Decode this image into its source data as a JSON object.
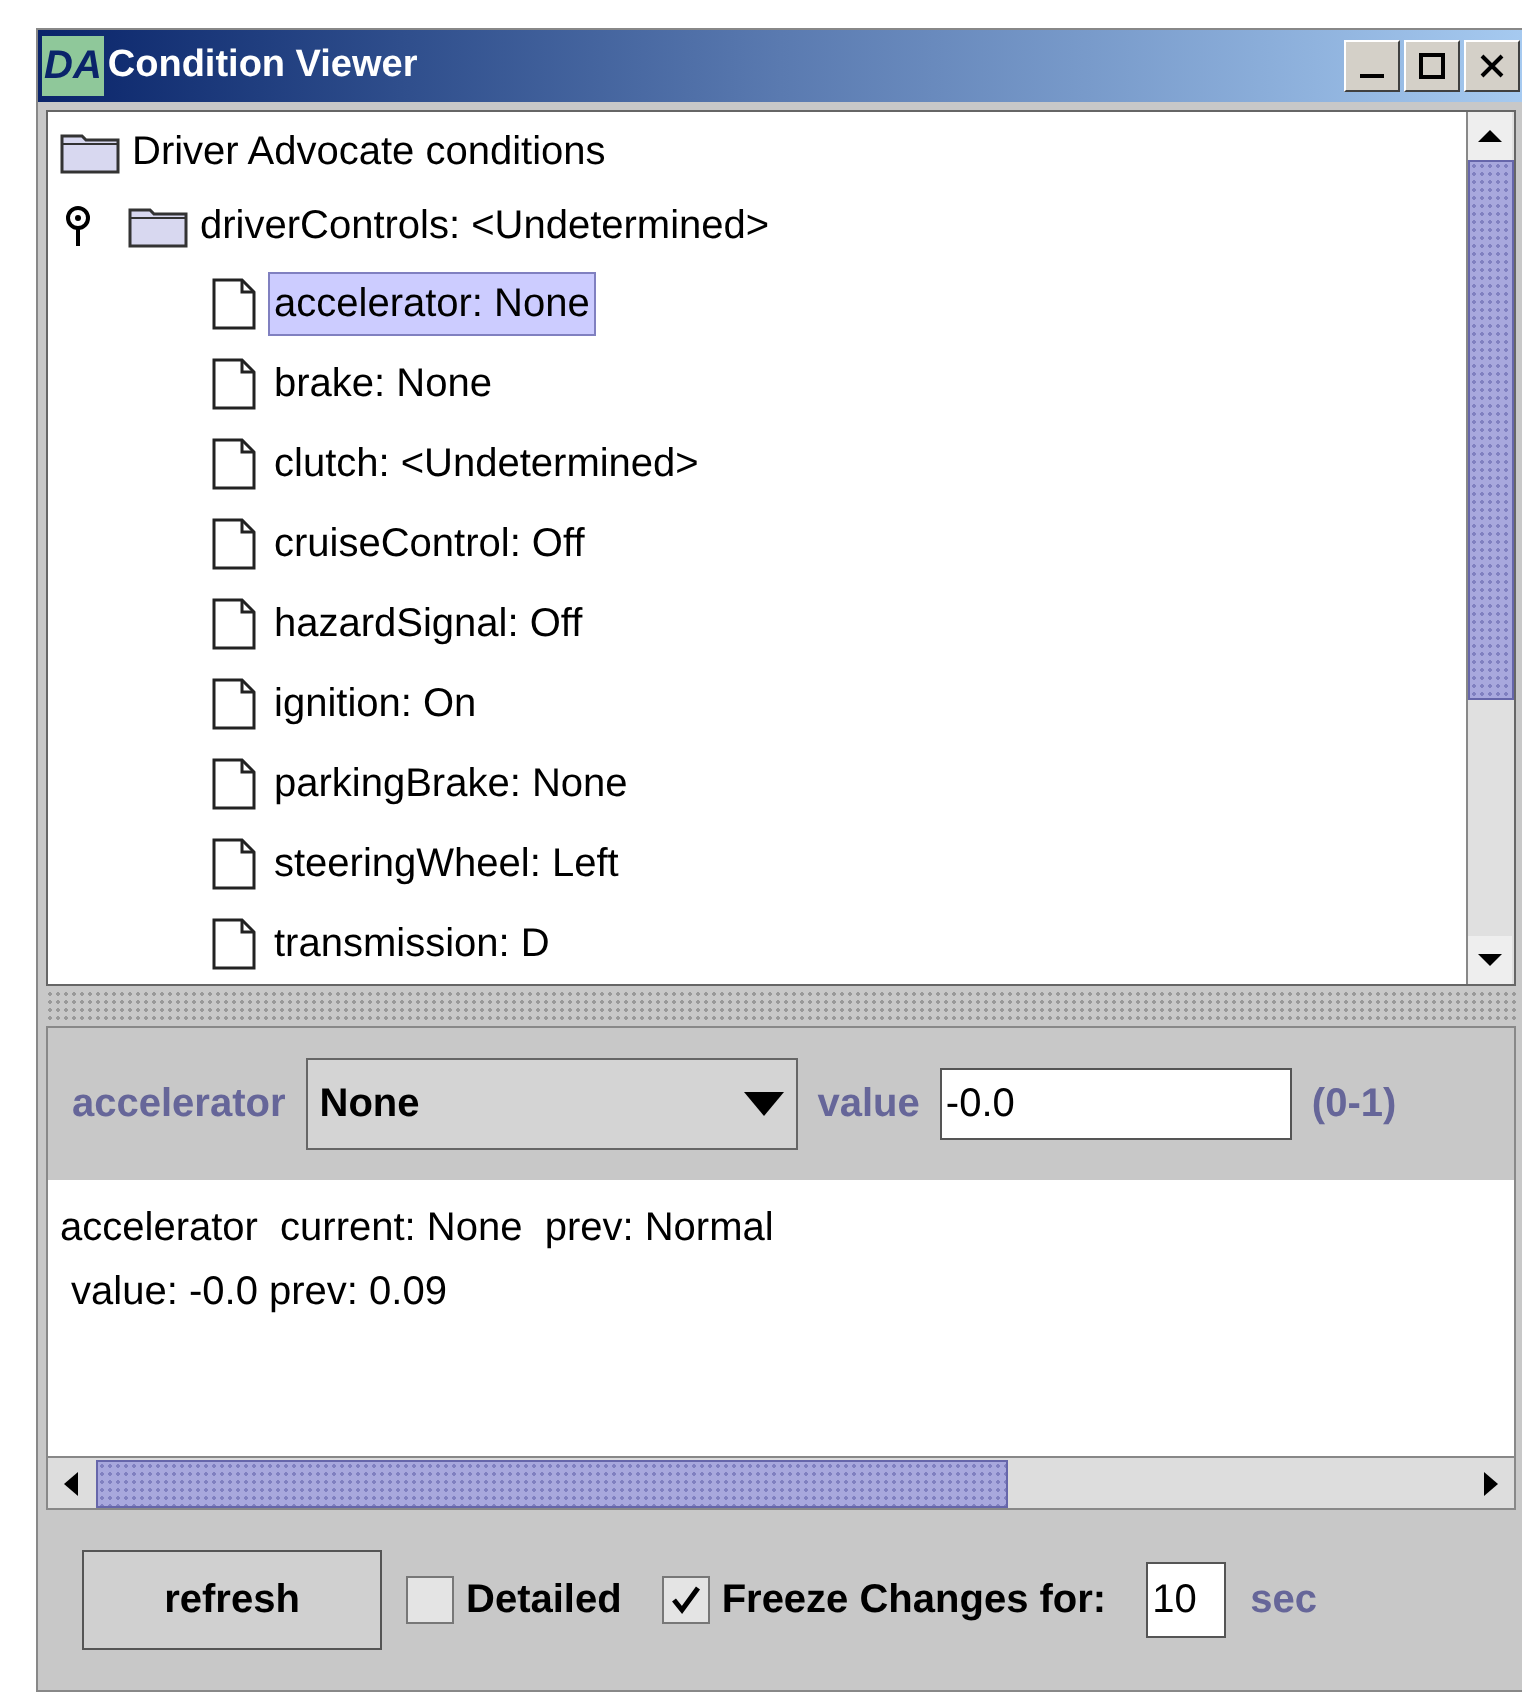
{
  "window": {
    "title": "Condition Viewer",
    "logo": "DA"
  },
  "tree": {
    "label": "Driver Advocate conditions",
    "children": [
      {
        "label": "driverControls: <Undetermined>",
        "expanded": true,
        "children": [
          {
            "label": "accelerator: None",
            "selected": true
          },
          {
            "label": "brake: None",
            "selected": false
          },
          {
            "label": "clutch: <Undetermined>",
            "selected": false
          },
          {
            "label": "cruiseControl: Off",
            "selected": false
          },
          {
            "label": "hazardSignal: Off",
            "selected": false
          },
          {
            "label": "ignition: On",
            "selected": false
          },
          {
            "label": "parkingBrake: None",
            "selected": false
          },
          {
            "label": "steeringWheel: Left",
            "selected": false
          },
          {
            "label": "transmission: D",
            "selected": false
          }
        ]
      }
    ]
  },
  "editor": {
    "name": "accelerator",
    "state": "None",
    "value_label": "value",
    "value": "-0.0",
    "range": "(0-1)"
  },
  "details": [
    "accelerator  current: None  prev: Normal",
    " value: -0.0 prev: 0.09"
  ],
  "bottom": {
    "refresh": "refresh",
    "detailed": {
      "label": "Detailed",
      "checked": false
    },
    "freeze": {
      "label": "Freeze Changes for:",
      "checked": true
    },
    "seconds": "10",
    "unit": "sec"
  }
}
